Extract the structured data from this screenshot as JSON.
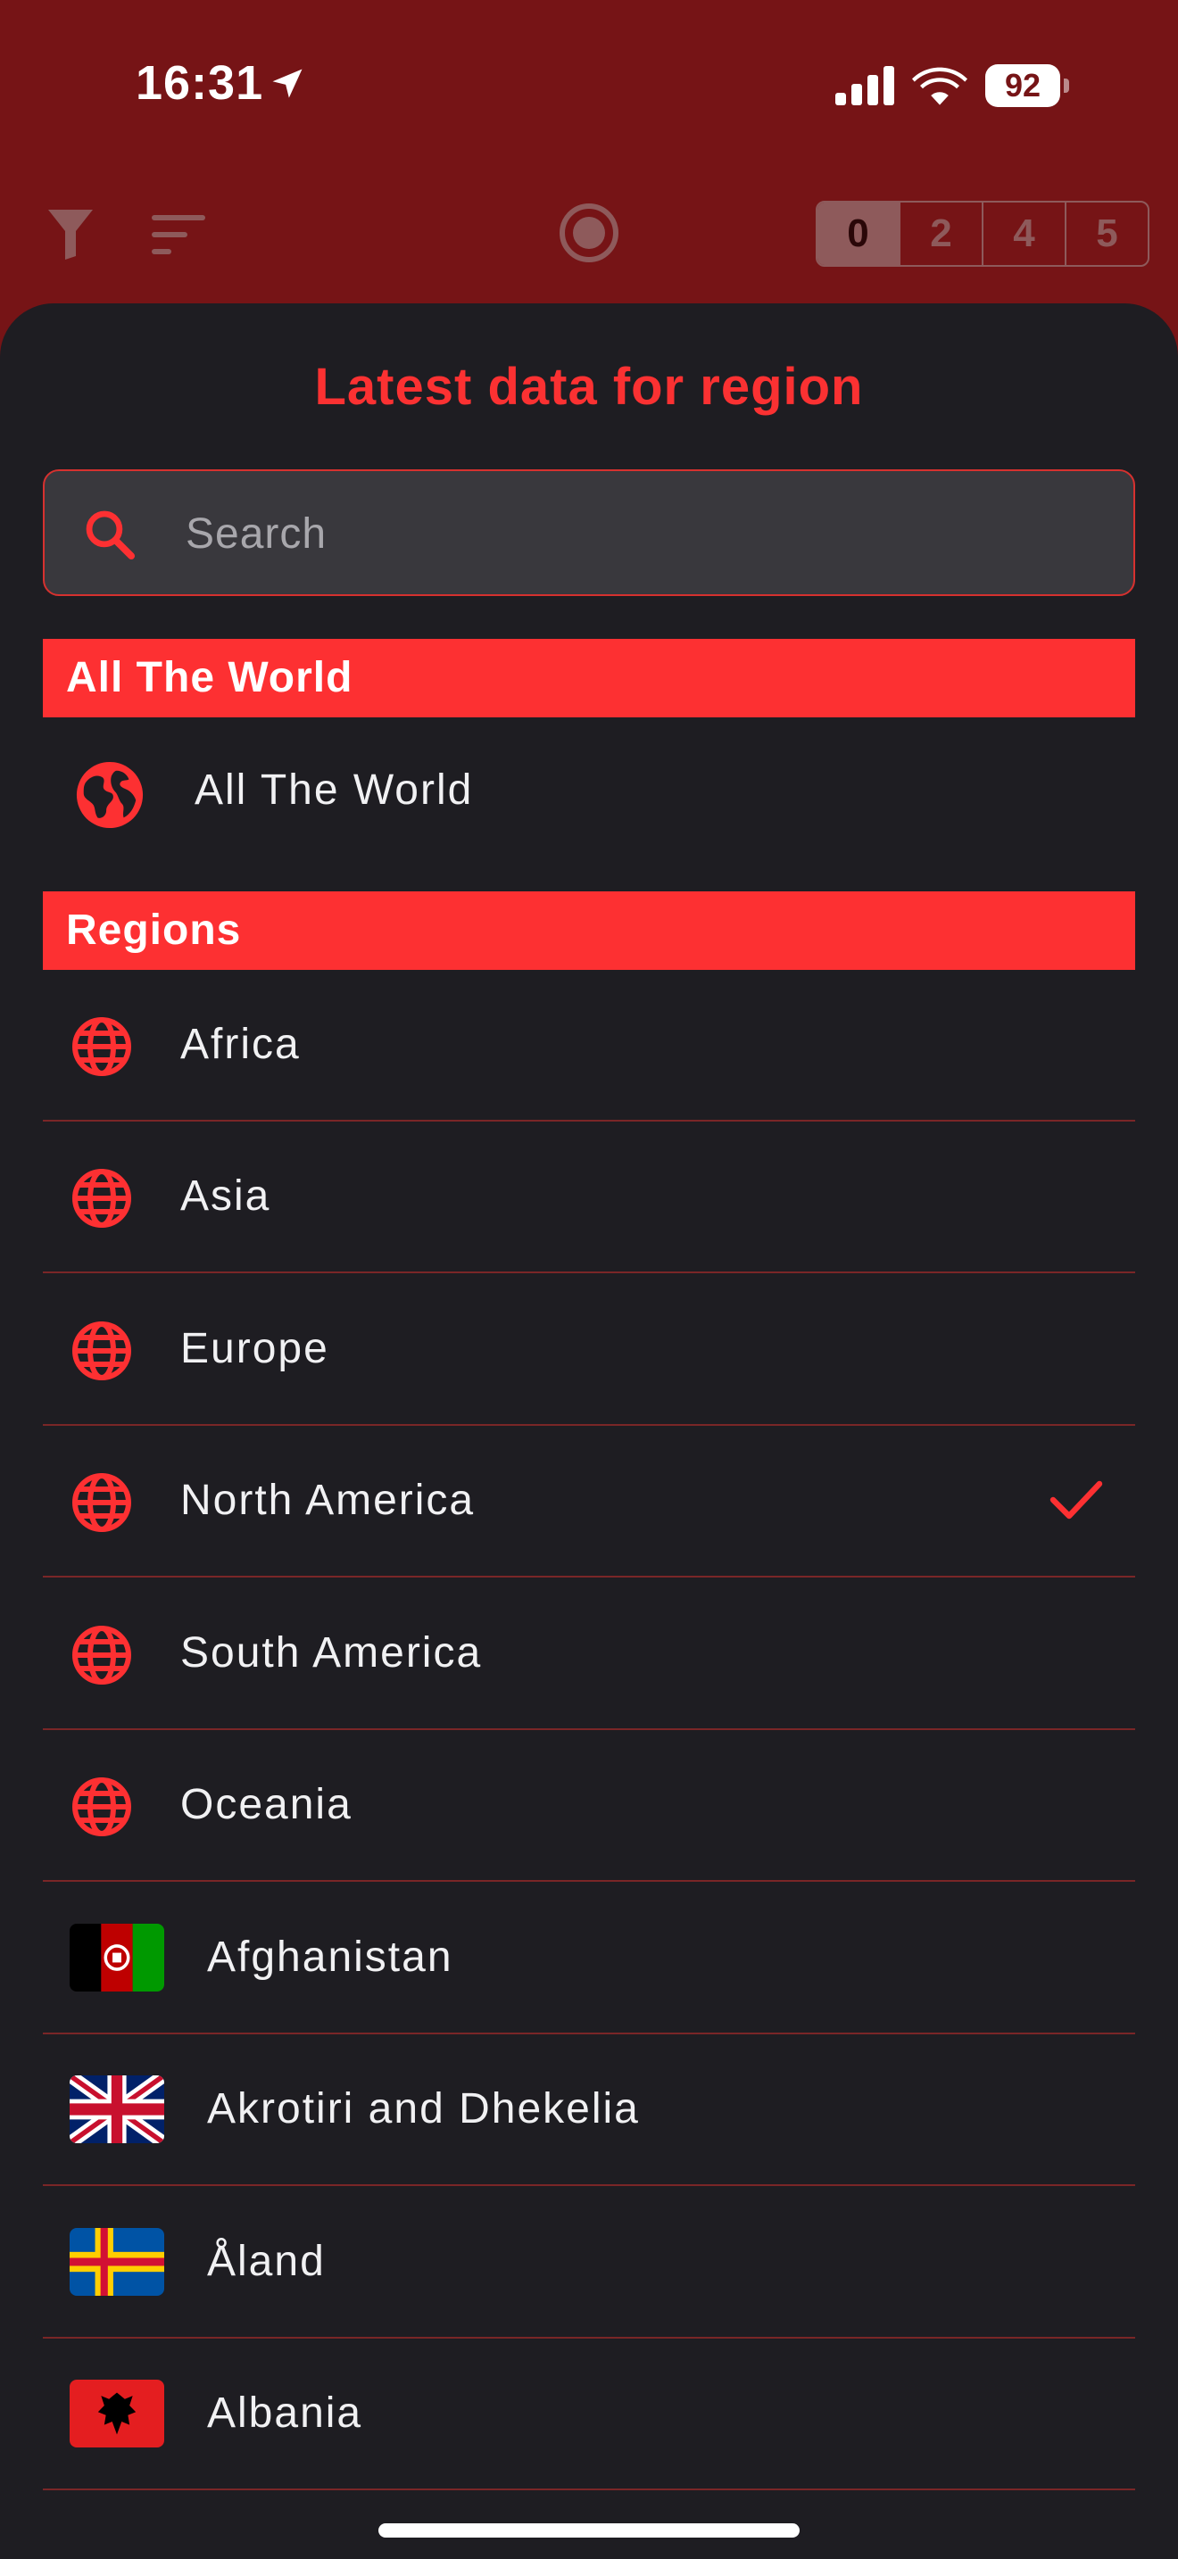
{
  "status_bar": {
    "time": "16:31",
    "battery": "92"
  },
  "toolbar": {
    "segments": [
      "0",
      "2",
      "4",
      "5"
    ],
    "active_segment": "0"
  },
  "sheet": {
    "title": "Latest data for region",
    "search": {
      "placeholder": "Search",
      "value": ""
    },
    "sections": [
      {
        "header": "All The World",
        "items": [
          {
            "label": "All The World",
            "icon": "globe-filled-icon"
          }
        ]
      },
      {
        "header": "Regions",
        "items": [
          {
            "label": "Africa",
            "icon": "globe-icon"
          },
          {
            "label": "Asia",
            "icon": "globe-icon"
          },
          {
            "label": "Europe",
            "icon": "globe-icon"
          },
          {
            "label": "North America",
            "icon": "globe-icon",
            "selected": true
          },
          {
            "label": "South America",
            "icon": "globe-icon"
          },
          {
            "label": "Oceania",
            "icon": "globe-icon"
          },
          {
            "label": "Afghanistan",
            "icon": "flag-afghanistan-icon"
          },
          {
            "label": "Akrotiri and Dhekelia",
            "icon": "flag-united-kingdom-icon"
          },
          {
            "label": "Åland",
            "icon": "flag-aland-icon"
          },
          {
            "label": "Albania",
            "icon": "flag-albania-icon"
          }
        ]
      }
    ]
  },
  "colors": {
    "accent": "#fd3032",
    "header_bg": "#761416",
    "sheet_bg": "#1e1d22",
    "search_bg": "#39383d"
  }
}
